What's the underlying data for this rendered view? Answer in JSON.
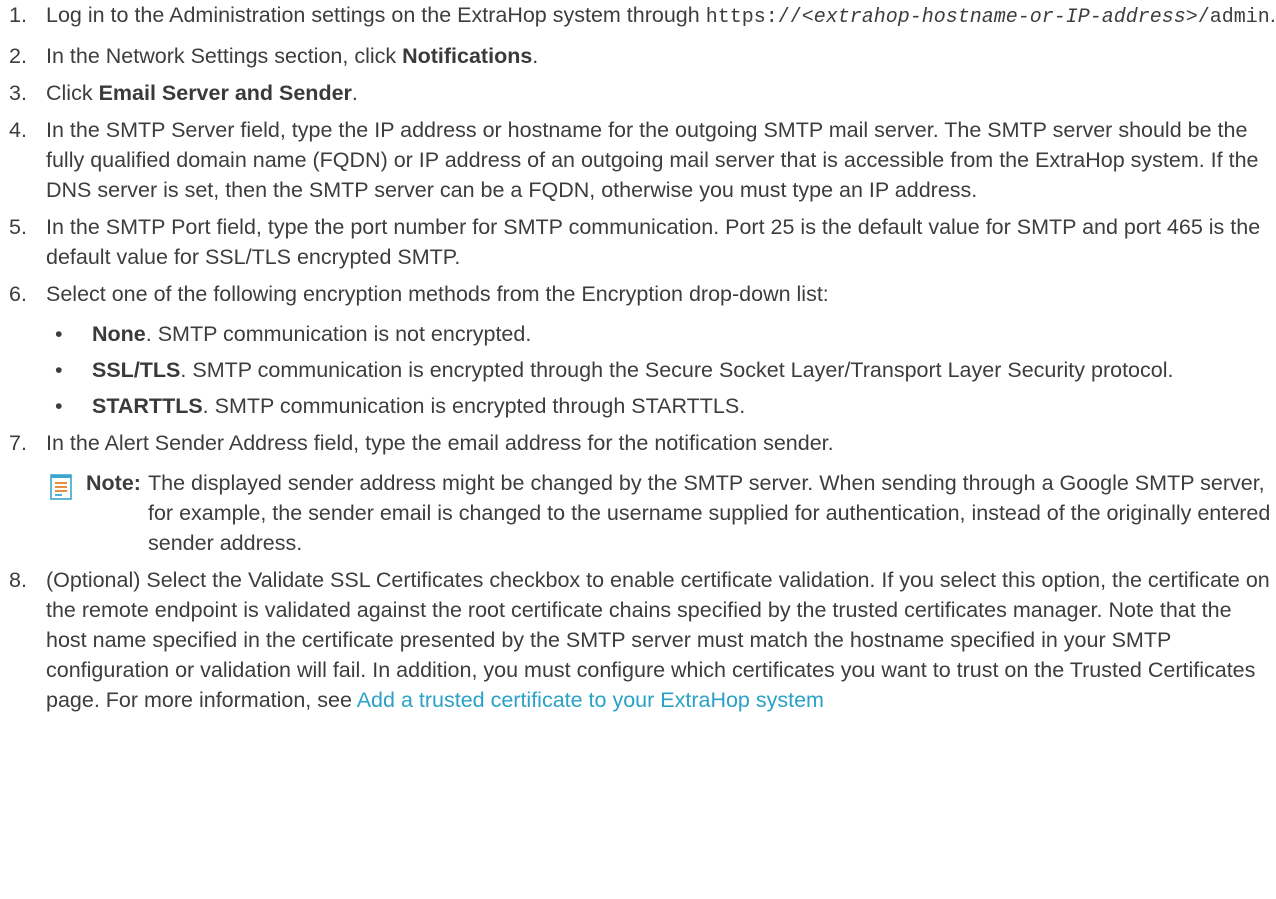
{
  "steps": [
    {
      "num": "1.",
      "text_before": "Log in to the Administration settings on the ExtraHop system through ",
      "code_prefix": "https://<",
      "code_var": "extrahop-hostname-or-IP-address",
      "code_suffix": ">/admin",
      "text_after": "."
    },
    {
      "num": "2.",
      "text_before": "In the Network Settings section, click ",
      "bold": "Notifications",
      "text_after": "."
    },
    {
      "num": "3.",
      "text_before": "Click ",
      "bold": "Email Server and Sender",
      "text_after": "."
    },
    {
      "num": "4.",
      "text": "In the SMTP Server field, type the IP address or hostname for the outgoing SMTP mail server. The SMTP server should be the fully qualified domain name (FQDN) or IP address of an outgoing mail server that is accessible from the ExtraHop system. If the DNS server is set, then the SMTP server can be a FQDN, otherwise you must type an IP address."
    },
    {
      "num": "5.",
      "text": "In the SMTP Port field, type the port number for SMTP communication. Port 25 is the default value for SMTP and port 465 is the default value for SSL/TLS encrypted SMTP."
    },
    {
      "num": "6.",
      "text": "Select one of the following encryption methods from the Encryption drop-down list:",
      "bullets": [
        {
          "bullet": "•",
          "bold": "None",
          "text": ". SMTP communication is not encrypted."
        },
        {
          "bullet": "•",
          "bold": "SSL/TLS",
          "text": ". SMTP communication is encrypted through the Secure Socket Layer/Transport Layer Security protocol."
        },
        {
          "bullet": "•",
          "bold": "STARTTLS",
          "text": ". SMTP communication is encrypted through STARTTLS."
        }
      ]
    },
    {
      "num": "7.",
      "text": "In the Alert Sender Address field, type the email address for the notification sender.",
      "note": {
        "label": "Note:",
        "text": "The displayed sender address might be changed by the SMTP server. When sending through a Google SMTP server, for example, the sender email is changed to the username supplied for authentication, instead of the originally entered sender address.",
        "icon": "note-icon",
        "icon_color": "#3aa6cf",
        "icon_accent": "#e8812f"
      }
    },
    {
      "num": "8.",
      "text": "(Optional) Select the Validate SSL Certificates checkbox to enable certificate validation. If you select this option, the certificate on the remote endpoint is validated against the root certificate chains specified by the trusted certificates manager. Note that the host name specified in the certificate presented by the SMTP server must match the hostname specified in your SMTP configuration or validation will fail. In addition, you must configure which certificates you want to trust on the Trusted Certificates page. For more information, see ",
      "link": "Add a trusted certificate to your ExtraHop system"
    }
  ],
  "colors": {
    "text": "#3d3d3d",
    "link": "#2aa1c6"
  }
}
